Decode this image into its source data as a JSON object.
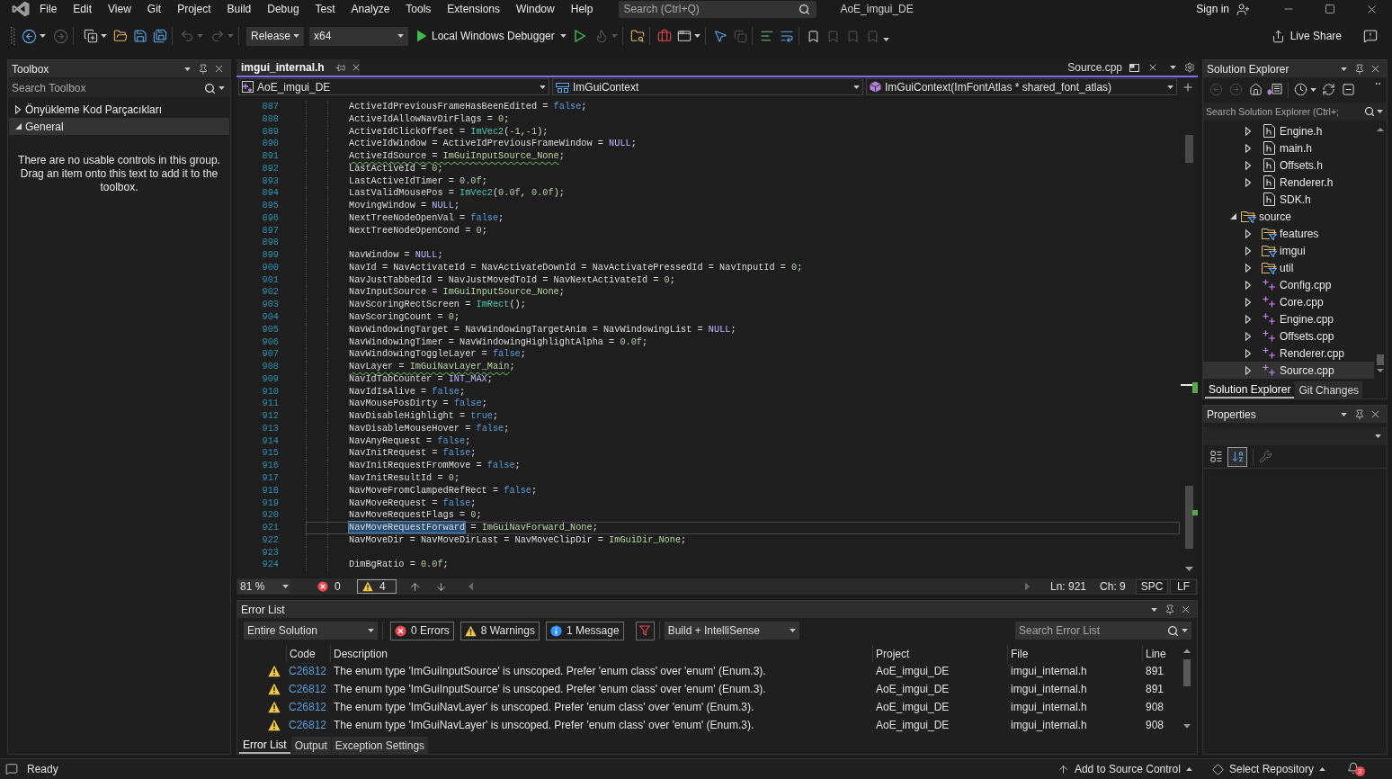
{
  "title_bar": {
    "menu": [
      "File",
      "Edit",
      "View",
      "Git",
      "Project",
      "Build",
      "Debug",
      "Test",
      "Analyze",
      "Tools",
      "Extensions",
      "Window",
      "Help"
    ],
    "search": {
      "placeholder": "Search (Ctrl+Q)"
    },
    "solution_name": "AoE_imgui_DE",
    "sign_in": "Sign in"
  },
  "toolbar": {
    "configuration": "Release",
    "platform": "x64",
    "debugger": "Local Windows Debugger",
    "live_share": "Live Share"
  },
  "toolbox": {
    "title": "Toolbox",
    "search": {
      "placeholder": "Search Toolbox"
    },
    "groups": [
      {
        "label": "Önyükleme Kod Parçacıkları",
        "expanded": false,
        "selected": false
      },
      {
        "label": "General",
        "expanded": true,
        "selected": true
      }
    ],
    "empty_message": "There are no usable controls in this group. Drag an item onto this text to add it to the toolbox."
  },
  "editor": {
    "tabs": [
      {
        "label": "imgui_internal.h",
        "kind": "document",
        "selected": true
      },
      {
        "label": "Source.cpp",
        "kind": "preview",
        "selected": false
      }
    ],
    "navigation": [
      {
        "kind": "project",
        "label": "AoE_imgui_DE"
      },
      {
        "kind": "type",
        "label": "ImGuiContext"
      },
      {
        "kind": "member",
        "label": "ImGuiContext(ImFontAtlas * shared_font_atlas)"
      }
    ],
    "lines": [
      {
        "number": "887",
        "tokens": [
          {
            "kind": "plain",
            "text": "ActiveIdPreviousFrameHasBeenEdited = "
          },
          {
            "kind": "keyword",
            "text": "false"
          },
          {
            "kind": "plain",
            "text": ";"
          }
        ]
      },
      {
        "number": "888",
        "tokens": [
          {
            "kind": "plain",
            "text": "ActiveIdAllowNavDirFlags = "
          },
          {
            "kind": "number",
            "text": "0"
          },
          {
            "kind": "plain",
            "text": ";"
          }
        ]
      },
      {
        "number": "889",
        "tokens": [
          {
            "kind": "plain",
            "text": "ActiveIdClickOffset = "
          },
          {
            "kind": "type",
            "text": "ImVec2"
          },
          {
            "kind": "plain",
            "text": "("
          },
          {
            "kind": "number",
            "text": "-1"
          },
          {
            "kind": "plain",
            "text": ","
          },
          {
            "kind": "number",
            "text": "-1"
          },
          {
            "kind": "plain",
            "text": ");"
          }
        ]
      },
      {
        "number": "890",
        "tokens": [
          {
            "kind": "plain",
            "text": "ActiveIdWindow = ActiveIdPreviousFrameWindow = "
          },
          {
            "kind": "macro",
            "text": "NULL"
          },
          {
            "kind": "plain",
            "text": ";"
          }
        ]
      },
      {
        "number": "891",
        "tokens": [
          {
            "kind": "plain",
            "text": "ActiveIdSource = ",
            "squiggle": true
          },
          {
            "kind": "enum",
            "text": "ImGuiInputSource_None",
            "squiggle": true
          },
          {
            "kind": "plain",
            "text": ";"
          }
        ]
      },
      {
        "number": "892",
        "tokens": [
          {
            "kind": "plain",
            "text": "LastActiveId = "
          },
          {
            "kind": "number",
            "text": "0"
          },
          {
            "kind": "plain",
            "text": ";"
          }
        ]
      },
      {
        "number": "893",
        "tokens": [
          {
            "kind": "plain",
            "text": "LastActiveIdTimer = "
          },
          {
            "kind": "number",
            "text": "0.0f"
          },
          {
            "kind": "plain",
            "text": ";"
          }
        ]
      },
      {
        "number": "894",
        "tokens": [
          {
            "kind": "plain",
            "text": "LastValidMousePos = "
          },
          {
            "kind": "type",
            "text": "ImVec2"
          },
          {
            "kind": "plain",
            "text": "("
          },
          {
            "kind": "number",
            "text": "0.0f"
          },
          {
            "kind": "plain",
            "text": ", "
          },
          {
            "kind": "number",
            "text": "0.0f"
          },
          {
            "kind": "plain",
            "text": ");"
          }
        ]
      },
      {
        "number": "895",
        "tokens": [
          {
            "kind": "plain",
            "text": "MovingWindow = "
          },
          {
            "kind": "macro",
            "text": "NULL"
          },
          {
            "kind": "plain",
            "text": ";"
          }
        ]
      },
      {
        "number": "896",
        "tokens": [
          {
            "kind": "plain",
            "text": "NextTreeNodeOpenVal = "
          },
          {
            "kind": "keyword",
            "text": "false"
          },
          {
            "kind": "plain",
            "text": ";"
          }
        ]
      },
      {
        "number": "897",
        "tokens": [
          {
            "kind": "plain",
            "text": "NextTreeNodeOpenCond = "
          },
          {
            "kind": "number",
            "text": "0"
          },
          {
            "kind": "plain",
            "text": ";"
          }
        ]
      },
      {
        "number": "898"
      },
      {
        "number": "899",
        "tokens": [
          {
            "kind": "plain",
            "text": "NavWindow = "
          },
          {
            "kind": "macro",
            "text": "NULL"
          },
          {
            "kind": "plain",
            "text": ";"
          }
        ]
      },
      {
        "number": "900",
        "tokens": [
          {
            "kind": "plain",
            "text": "NavId = NavActivateId = NavActivateDownId = NavActivatePressedId = NavInputId = "
          },
          {
            "kind": "number",
            "text": "0"
          },
          {
            "kind": "plain",
            "text": ";"
          }
        ]
      },
      {
        "number": "901",
        "tokens": [
          {
            "kind": "plain",
            "text": "NavJustTabbedId = NavJustMovedToId = NavNextActivateId = "
          },
          {
            "kind": "number",
            "text": "0"
          },
          {
            "kind": "plain",
            "text": ";"
          }
        ]
      },
      {
        "number": "902",
        "tokens": [
          {
            "kind": "plain",
            "text": "NavInputSource = "
          },
          {
            "kind": "enum",
            "text": "ImGuiInputSource_None"
          },
          {
            "kind": "plain",
            "text": ";"
          }
        ]
      },
      {
        "number": "903",
        "tokens": [
          {
            "kind": "plain",
            "text": "NavScoringRectScreen = "
          },
          {
            "kind": "type",
            "text": "ImRect"
          },
          {
            "kind": "plain",
            "text": "();"
          }
        ]
      },
      {
        "number": "904",
        "tokens": [
          {
            "kind": "plain",
            "text": "NavScoringCount = "
          },
          {
            "kind": "number",
            "text": "0"
          },
          {
            "kind": "plain",
            "text": ";"
          }
        ]
      },
      {
        "number": "905",
        "tokens": [
          {
            "kind": "plain",
            "text": "NavWindowingTarget = NavWindowingTargetAnim = NavWindowingList = "
          },
          {
            "kind": "macro",
            "text": "NULL"
          },
          {
            "kind": "plain",
            "text": ";"
          }
        ]
      },
      {
        "number": "906",
        "tokens": [
          {
            "kind": "plain",
            "text": "NavWindowingTimer = NavWindowingHighlightAlpha = "
          },
          {
            "kind": "number",
            "text": "0.0f"
          },
          {
            "kind": "plain",
            "text": ";"
          }
        ]
      },
      {
        "number": "907",
        "tokens": [
          {
            "kind": "plain",
            "text": "NavWindowingToggleLayer = "
          },
          {
            "kind": "keyword",
            "text": "false"
          },
          {
            "kind": "plain",
            "text": ";"
          }
        ]
      },
      {
        "number": "908",
        "tokens": [
          {
            "kind": "plain",
            "text": "NavLayer = ",
            "squiggle": true
          },
          {
            "kind": "enum",
            "text": "ImGuiNavLayer_Main",
            "squiggle": true
          },
          {
            "kind": "plain",
            "text": ";"
          }
        ]
      },
      {
        "number": "909",
        "tokens": [
          {
            "kind": "plain",
            "text": "NavIdTabCounter = "
          },
          {
            "kind": "macro",
            "text": "INT_MAX"
          },
          {
            "kind": "plain",
            "text": ";"
          }
        ]
      },
      {
        "number": "910",
        "tokens": [
          {
            "kind": "plain",
            "text": "NavIdIsAlive = "
          },
          {
            "kind": "keyword",
            "text": "false"
          },
          {
            "kind": "plain",
            "text": ";"
          }
        ]
      },
      {
        "number": "911",
        "tokens": [
          {
            "kind": "plain",
            "text": "NavMousePosDirty = "
          },
          {
            "kind": "keyword",
            "text": "false"
          },
          {
            "kind": "plain",
            "text": ";"
          }
        ]
      },
      {
        "number": "912",
        "tokens": [
          {
            "kind": "plain",
            "text": "NavDisableHighlight = "
          },
          {
            "kind": "keyword",
            "text": "true"
          },
          {
            "kind": "plain",
            "text": ";"
          }
        ]
      },
      {
        "number": "913",
        "tokens": [
          {
            "kind": "plain",
            "text": "NavDisableMouseHover = "
          },
          {
            "kind": "keyword",
            "text": "false"
          },
          {
            "kind": "plain",
            "text": ";"
          }
        ]
      },
      {
        "number": "914",
        "tokens": [
          {
            "kind": "plain",
            "text": "NavAnyRequest = "
          },
          {
            "kind": "keyword",
            "text": "false"
          },
          {
            "kind": "plain",
            "text": ";"
          }
        ]
      },
      {
        "number": "915",
        "tokens": [
          {
            "kind": "plain",
            "text": "NavInitRequest = "
          },
          {
            "kind": "keyword",
            "text": "false"
          },
          {
            "kind": "plain",
            "text": ";"
          }
        ]
      },
      {
        "number": "916",
        "tokens": [
          {
            "kind": "plain",
            "text": "NavInitRequestFromMove = "
          },
          {
            "kind": "keyword",
            "text": "false"
          },
          {
            "kind": "plain",
            "text": ";"
          }
        ]
      },
      {
        "number": "917",
        "tokens": [
          {
            "kind": "plain",
            "text": "NavInitResultId = "
          },
          {
            "kind": "number",
            "text": "0"
          },
          {
            "kind": "plain",
            "text": ";"
          }
        ]
      },
      {
        "number": "918",
        "tokens": [
          {
            "kind": "plain",
            "text": "NavMoveFromClampedRefRect = "
          },
          {
            "kind": "keyword",
            "text": "false"
          },
          {
            "kind": "plain",
            "text": ";"
          }
        ]
      },
      {
        "number": "919",
        "tokens": [
          {
            "kind": "plain",
            "text": "NavMoveRequest = "
          },
          {
            "kind": "keyword",
            "text": "false"
          },
          {
            "kind": "plain",
            "text": ";"
          }
        ]
      },
      {
        "number": "920",
        "tokens": [
          {
            "kind": "plain",
            "text": "NavMoveRequestFlags = "
          },
          {
            "kind": "number",
            "text": "0"
          },
          {
            "kind": "plain",
            "text": ";"
          }
        ]
      },
      {
        "number": "921",
        "current": true,
        "tokens": [
          {
            "kind": "plain",
            "text": "NavMoveRequestForward",
            "highlighted": true
          },
          {
            "kind": "plain",
            "text": " = "
          },
          {
            "kind": "enum",
            "text": "ImGuiNavForward_None"
          },
          {
            "kind": "plain",
            "text": ";"
          }
        ]
      },
      {
        "number": "922",
        "tokens": [
          {
            "kind": "plain",
            "text": "NavMoveDir = NavMoveDirLast = NavMoveClipDir = "
          },
          {
            "kind": "enum",
            "text": "ImGuiDir_None"
          },
          {
            "kind": "plain",
            "text": ";"
          }
        ]
      },
      {
        "number": "923"
      },
      {
        "number": "924",
        "tokens": [
          {
            "kind": "plain",
            "text": "DimBgRatio = "
          },
          {
            "kind": "number",
            "text": "0.0f"
          },
          {
            "kind": "plain",
            "text": ";"
          }
        ]
      }
    ],
    "status": {
      "zoom": "81 %",
      "issues": [
        {
          "kind": "error",
          "count": "0",
          "selected": false
        },
        {
          "kind": "warning",
          "count": "4",
          "selected": true
        }
      ],
      "line": "Ln: 921",
      "column": "Ch: 9",
      "indent": "SPC",
      "line_ending": "LF"
    }
  },
  "error_list": {
    "title": "Error List",
    "scope": "Entire Solution",
    "filters": [
      {
        "kind": "error",
        "label": "0 Errors",
        "on": true
      },
      {
        "kind": "warning",
        "label": "8 Warnings",
        "on": true
      },
      {
        "kind": "message",
        "label": "1 Message",
        "on": true
      }
    ],
    "source": "Build + IntelliSense",
    "search": {
      "placeholder": "Search Error List"
    },
    "columns": [
      "Code",
      "Description",
      "Project",
      "File",
      "Line"
    ],
    "rows": [
      {
        "kind": "warning",
        "code": "C26812",
        "description": "The enum type 'ImGuiInputSource' is unscoped. Prefer 'enum class' over 'enum' (Enum.3).",
        "project": "AoE_imgui_DE",
        "file": "imgui_internal.h",
        "line": "891"
      },
      {
        "kind": "warning",
        "code": "C26812",
        "description": "The enum type 'ImGuiInputSource' is unscoped. Prefer 'enum class' over 'enum' (Enum.3).",
        "project": "AoE_imgui_DE",
        "file": "imgui_internal.h",
        "line": "891"
      },
      {
        "kind": "warning",
        "code": "C26812",
        "description": "The enum type 'ImGuiNavLayer' is unscoped. Prefer 'enum class' over 'enum' (Enum.3).",
        "project": "AoE_imgui_DE",
        "file": "imgui_internal.h",
        "line": "908"
      },
      {
        "kind": "warning",
        "code": "C26812",
        "description": "The enum type 'ImGuiNavLayer' is unscoped. Prefer 'enum class' over 'enum' (Enum.3).",
        "project": "AoE_imgui_DE",
        "file": "imgui_internal.h",
        "line": "908"
      }
    ],
    "tabs": [
      {
        "label": "Error List",
        "selected": true
      },
      {
        "label": "Output",
        "selected": false
      },
      {
        "label": "Exception Settings",
        "selected": false
      }
    ]
  },
  "solution_explorer": {
    "title": "Solution Explorer",
    "search": {
      "placeholder": "Search Solution Explorer (Ctrl+;"
    },
    "tree": [
      {
        "children": [
          {
            "label": "Engine.h",
            "kind": "header",
            "expanded": false,
            "selected": false
          },
          {
            "label": "main.h",
            "kind": "header",
            "expanded": false,
            "selected": false
          },
          {
            "label": "Offsets.h",
            "kind": "header",
            "expanded": false,
            "selected": false
          },
          {
            "label": "Renderer.h",
            "kind": "header",
            "expanded": false,
            "selected": false
          },
          {
            "label": "SDK.h",
            "kind": "header",
            "selected": false
          }
        ]
      },
      {
        "label": "source",
        "kind": "filter",
        "expanded": true,
        "selected": false,
        "children": [
          {
            "label": "features",
            "kind": "filter",
            "expanded": false,
            "selected": false
          },
          {
            "label": "imgui",
            "kind": "filter",
            "expanded": false,
            "selected": false
          },
          {
            "label": "util",
            "kind": "filter",
            "expanded": false,
            "selected": false
          },
          {
            "label": "Config.cpp",
            "kind": "cpp",
            "expanded": false,
            "selected": false
          },
          {
            "label": "Core.cpp",
            "kind": "cpp",
            "expanded": false,
            "selected": false
          },
          {
            "label": "Engine.cpp",
            "kind": "cpp",
            "expanded": false,
            "selected": false
          },
          {
            "label": "Offsets.cpp",
            "kind": "cpp",
            "expanded": false,
            "selected": false
          },
          {
            "label": "Renderer.cpp",
            "kind": "cpp",
            "expanded": false,
            "selected": false
          },
          {
            "label": "Source.cpp",
            "kind": "cpp",
            "expanded": false,
            "selected": true
          }
        ]
      }
    ],
    "tabs": [
      {
        "label": "Solution Explorer",
        "selected": true
      },
      {
        "label": "Git Changes",
        "selected": false
      }
    ]
  },
  "properties": {
    "title": "Properties",
    "sort_buttons": [
      {
        "kind": "categorized",
        "selected": false
      },
      {
        "kind": "alphabetical",
        "selected": true
      }
    ]
  },
  "status_bar": {
    "message": "Ready",
    "source_control": "Add to Source Control",
    "repository": "Select Repository",
    "notifications": "2"
  }
}
